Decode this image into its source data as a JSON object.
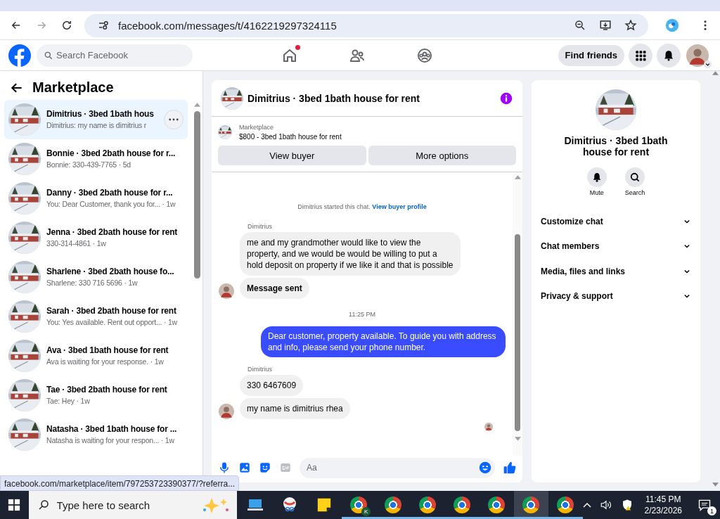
{
  "browser": {
    "nav": [
      {
        "kind": "back",
        "disabled": false
      },
      {
        "kind": "forward",
        "disabled": true
      },
      {
        "kind": "reload",
        "disabled": false
      }
    ],
    "url": "facebook.com/messages/t/4162219297324115"
  },
  "header": {
    "search": {
      "placeholder": "Search Facebook"
    },
    "nav": [
      {
        "kind": "home",
        "badge": true
      },
      {
        "kind": "friends",
        "badge": false
      },
      {
        "kind": "groups",
        "badge": false
      }
    ],
    "find_friends": "Find friends"
  },
  "sidebar": {
    "title": "Marketplace",
    "conversations": [
      {
        "title": "Dimitrius · 3bed 1bath hous",
        "preview": "Dimitrius: my name is dimitrius r",
        "selected": true
      },
      {
        "title": "Bonnie · 3bed 2bath house for r...",
        "preview": "Bonnie: 330-439-7765 · 5d",
        "selected": false
      },
      {
        "title": "Danny · 3bed 2bath house for r...",
        "preview": "You: Dear Customer, thank you for... · 1w",
        "selected": false
      },
      {
        "title": "Jenna · 3bed 2bath house for rent",
        "preview": "330-314-4861 · 1w",
        "selected": false
      },
      {
        "title": "Sharlene · 3bed 2bath house fo...",
        "preview": "Sharlene: 330 716 5696 · 1w",
        "selected": false
      },
      {
        "title": "Sarah · 3bed 2bath house for rent",
        "preview": "You: Yes available. Rent out opport... · 1w",
        "selected": false
      },
      {
        "title": "Ava · 3bed 1bath house for rent",
        "preview": "Ava is waiting for your response. · 1w",
        "selected": false
      },
      {
        "title": "Tae · 3bed 2bath house for rent",
        "preview": "Tae: Hey · 1w",
        "selected": false
      },
      {
        "title": "Natasha · 3bed 1bath house for ...",
        "preview": "Natasha is waiting for your respon... · 1w",
        "selected": false
      }
    ]
  },
  "chat": {
    "title": "Dimitrius · 3bed 1bath house for rent",
    "listing": {
      "label": "Marketplace",
      "title": "$800 - 3bed 1bath house for rent"
    },
    "buttons": [
      "View buyer",
      "More options"
    ],
    "messages": [
      {
        "kind": "notice",
        "text": "Dimitrius started this chat.",
        "link": "View buyer profile"
      },
      {
        "kind": "sender",
        "text": "Dimitrius"
      },
      {
        "kind": "incoming",
        "text": "me and my grandmother would like to view the property, and we would be would be willing to put a hold deposit on property if we like it and that is possible",
        "avatar": false,
        "bold": false
      },
      {
        "kind": "incoming",
        "text": "Message sent",
        "avatar": true,
        "bold": true
      },
      {
        "kind": "time",
        "text": "11:25 PM"
      },
      {
        "kind": "outgoing",
        "text": "Dear customer, property available. To guide you with address and info, please send your phone number."
      },
      {
        "kind": "sender",
        "text": "Dimitrius"
      },
      {
        "kind": "incoming",
        "text": "330 6467609",
        "avatar": false,
        "bold": false
      },
      {
        "kind": "incoming",
        "text": "my name is dimitrius rhea",
        "avatar": true,
        "bold": false
      }
    ],
    "composer": {
      "placeholder": "Aa"
    }
  },
  "details": {
    "title": "Dimitrius · 3bed 1bath house for rent",
    "actions": [
      {
        "kind": "mute",
        "label": "Mute"
      },
      {
        "kind": "search",
        "label": "Search"
      }
    ],
    "sections": [
      {
        "label": "Customize chat",
        "expanded": false
      },
      {
        "label": "Chat members",
        "expanded": false
      },
      {
        "label": "Media, files and links",
        "expanded": false
      },
      {
        "label": "Privacy & support",
        "expanded": false
      }
    ]
  },
  "status_url": "facebook.com/marketplace/item/797253723390377/?referra...",
  "taskbar": {
    "search": {
      "placeholder": "Type here to search"
    },
    "apps": [
      {
        "kind": "computer",
        "running": false,
        "selected": false
      },
      {
        "kind": "snip",
        "running": false,
        "selected": false
      },
      {
        "kind": "notes",
        "running": false,
        "selected": false
      },
      {
        "kind": "browser",
        "badge": "K",
        "running": true,
        "selected": false
      },
      {
        "kind": "browser",
        "running": true,
        "selected": false
      },
      {
        "kind": "browser",
        "running": true,
        "selected": false
      },
      {
        "kind": "browser",
        "running": true,
        "selected": false
      },
      {
        "kind": "browser",
        "running": true,
        "selected": false
      },
      {
        "kind": "browser",
        "running": true,
        "selected": true
      },
      {
        "kind": "browser",
        "running": true,
        "selected": false
      }
    ],
    "time": "11:45 PM",
    "date": "2/23/2026",
    "notifications": "1"
  }
}
